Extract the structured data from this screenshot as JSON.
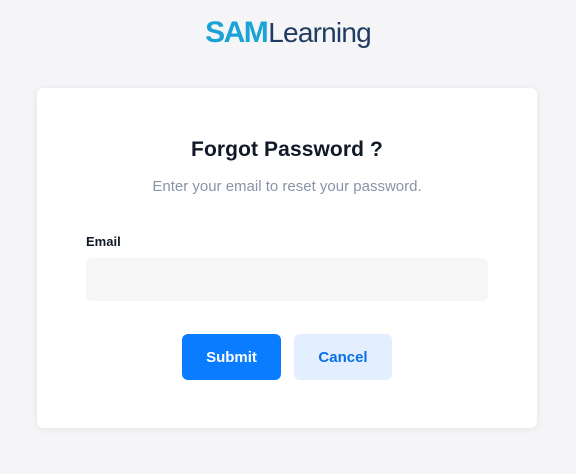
{
  "brand": {
    "logo_sam": "SAM",
    "logo_learning": "Learning",
    "colors": {
      "sam": "#1aa3d6",
      "learning": "#1f3b63"
    }
  },
  "form": {
    "title": "Forgot Password ?",
    "subtitle": "Enter your email to reset your password.",
    "email_label": "Email",
    "email_value": "",
    "email_placeholder": "",
    "submit_label": "Submit",
    "cancel_label": "Cancel"
  },
  "colors": {
    "primary": "#0a7cff",
    "secondary_bg": "#e3efff",
    "secondary_text": "#0a6fe6"
  }
}
